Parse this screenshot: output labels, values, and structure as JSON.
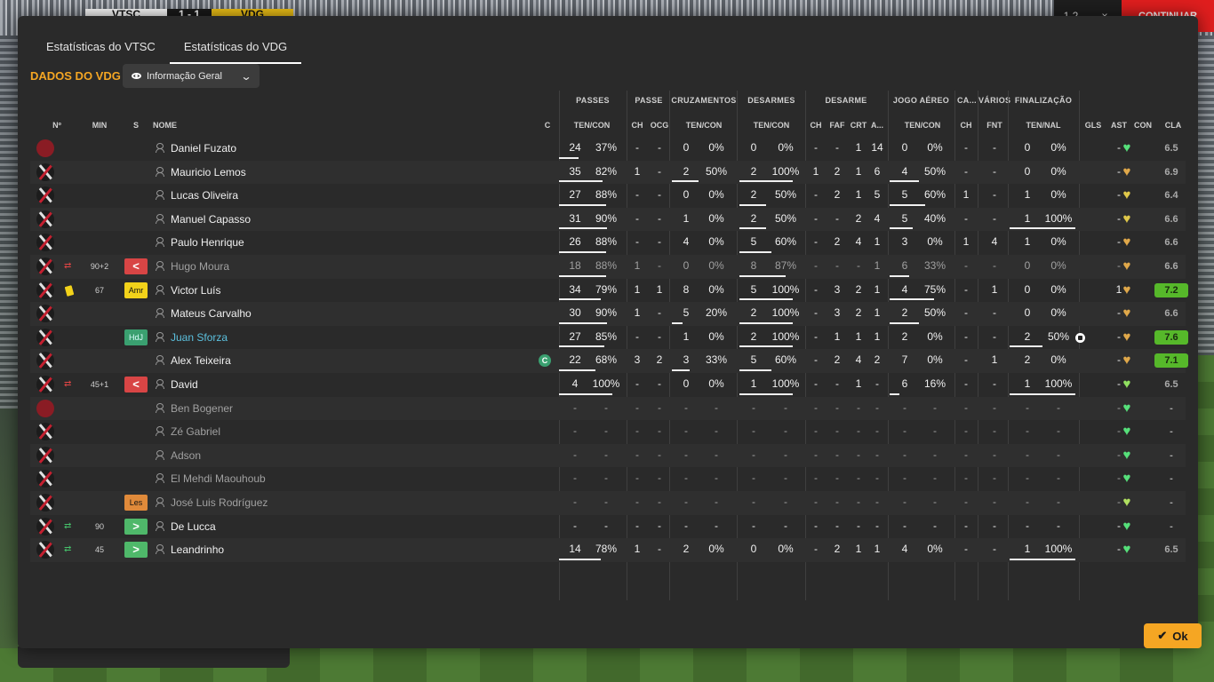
{
  "scorebar": {
    "home": "VTSC",
    "score": "1 - 1",
    "away": "VDG"
  },
  "topright": {
    "counter": "1 2",
    "close": "×",
    "continue_label": "CONTINUAR"
  },
  "tabs": [
    {
      "label": "Estatísticas do VTSC"
    },
    {
      "label": "Estatísticas do VDG"
    }
  ],
  "section_title": "DADOS DO VDG",
  "dropdown": {
    "selected": "Informação Geral",
    "icons": [
      "eye-icon",
      "chevron-down-icon"
    ]
  },
  "columns": {
    "groups": [
      "PASSES",
      "PASSE",
      "CRUZAMENTOS",
      "DESARMES",
      "DESARME",
      "JOGO AÉREO",
      "CA...",
      "VÁRIOS",
      "FINALIZAÇÃO"
    ],
    "sub": {
      "no": "Nº",
      "min": "MIN",
      "s": "S",
      "nome": "NOME",
      "c": "C",
      "passes": "TEN/CON",
      "passe_ch": "CH",
      "passe_ocg": "OCG",
      "cruz": "TEN/CON",
      "desarmes": "TEN/CON",
      "des_ch": "CH",
      "des_faf": "FAF",
      "des_crt": "CRT",
      "des_a": "A...",
      "aereo": "TEN/CON",
      "ca_ch": "CH",
      "var_fnt": "FNT",
      "fin": "TEN/NAL",
      "gls": "GLS",
      "ast": "AST",
      "con": "CON",
      "cla": "CLA"
    }
  },
  "colors": {
    "accent": "#f5a623",
    "panel": "#2a2a2a",
    "rating_good": "#56b82a",
    "link": "#5bc0de"
  },
  "players": [
    {
      "name": "Daniel Fuzato",
      "crest": "gk",
      "pas": [
        "24",
        "37%"
      ],
      "pas_f": 0.37,
      "ch": "-",
      "ocg": "-",
      "cru": [
        "0",
        "0%"
      ],
      "cru_f": 0,
      "des": [
        "0",
        "0%"
      ],
      "des_f": 0,
      "dch": "-",
      "faf": "-",
      "crt": "1",
      "a": "14",
      "aer": [
        "0",
        "0%"
      ],
      "aer_f": 0,
      "cach": "-",
      "fnt": "-",
      "fin": [
        "0",
        "0%"
      ],
      "fin_f": 0,
      "gls": "",
      "ast": "-",
      "con": "#56e07a",
      "cla": "6.5",
      "cla_good": false
    },
    {
      "name": "Mauricio Lemos",
      "pas": [
        "35",
        "82%"
      ],
      "pas_f": 0.82,
      "ch": "1",
      "ocg": "-",
      "cru": [
        "2",
        "50%"
      ],
      "cru_f": 0.5,
      "des": [
        "2",
        "100%"
      ],
      "des_f": 1,
      "dch": "1",
      "faf": "2",
      "crt": "1",
      "a": "6",
      "aer": [
        "4",
        "50%"
      ],
      "aer_f": 0.5,
      "cach": "-",
      "fnt": "-",
      "fin": [
        "0",
        "0%"
      ],
      "fin_f": 0,
      "gls": "",
      "ast": "-",
      "con": "#e0a84a",
      "cla": "6.9",
      "cla_good": false
    },
    {
      "name": "Lucas Oliveira",
      "pas": [
        "27",
        "88%"
      ],
      "pas_f": 0.88,
      "ch": "-",
      "ocg": "-",
      "cru": [
        "0",
        "0%"
      ],
      "cru_f": 0,
      "des": [
        "2",
        "50%"
      ],
      "des_f": 0.5,
      "dch": "-",
      "faf": "2",
      "crt": "1",
      "a": "5",
      "aer": [
        "5",
        "60%"
      ],
      "aer_f": 0.6,
      "cach": "1",
      "fnt": "-",
      "fin": [
        "1",
        "0%"
      ],
      "fin_f": 0,
      "gls": "",
      "ast": "-",
      "con": "#e0c84a",
      "cla": "6.4",
      "cla_good": false
    },
    {
      "name": "Manuel Capasso",
      "pas": [
        "31",
        "90%"
      ],
      "pas_f": 0.9,
      "ch": "-",
      "ocg": "-",
      "cru": [
        "1",
        "0%"
      ],
      "cru_f": 0,
      "des": [
        "2",
        "50%"
      ],
      "des_f": 0.5,
      "dch": "-",
      "faf": "-",
      "crt": "2",
      "a": "4",
      "aer": [
        "5",
        "40%"
      ],
      "aer_f": 0.4,
      "cach": "-",
      "fnt": "-",
      "fin": [
        "1",
        "100%"
      ],
      "fin_f": 1,
      "gls": "",
      "ast": "-",
      "con": "#e0c84a",
      "cla": "6.6",
      "cla_good": false
    },
    {
      "name": "Paulo Henrique",
      "pas": [
        "26",
        "88%"
      ],
      "pas_f": 0.88,
      "ch": "-",
      "ocg": "-",
      "cru": [
        "4",
        "0%"
      ],
      "cru_f": 0,
      "des": [
        "5",
        "60%"
      ],
      "des_f": 0.6,
      "dch": "-",
      "faf": "2",
      "crt": "4",
      "a": "1",
      "aer": [
        "3",
        "0%"
      ],
      "aer_f": 0,
      "cach": "1",
      "fnt": "4",
      "fin": [
        "1",
        "0%"
      ],
      "fin_f": 0,
      "gls": "",
      "ast": "-",
      "con": "#e0a84a",
      "cla": "6.6",
      "cla_good": false
    },
    {
      "name": "Hugo Moura",
      "dim": true,
      "sub": "out",
      "min": "90+2",
      "badge": "<",
      "badge_type": "red",
      "pas": [
        "18",
        "88%"
      ],
      "pas_f": 0.88,
      "ch": "1",
      "ocg": "-",
      "cru": [
        "0",
        "0%"
      ],
      "cru_f": 0,
      "des": [
        "8",
        "87%"
      ],
      "des_f": 0.87,
      "dch": "-",
      "faf": "-",
      "crt": "-",
      "a": "1",
      "aer": [
        "6",
        "33%"
      ],
      "aer_f": 0.33,
      "cach": "-",
      "fnt": "-",
      "fin": [
        "0",
        "0%"
      ],
      "fin_f": 0,
      "gls": "",
      "ast": "-",
      "con": "#e0a84a",
      "cla": "6.6",
      "cla_good": false
    },
    {
      "name": "Victor Luís",
      "card": true,
      "min": "67",
      "badge": "Amr",
      "badge_type": "amr",
      "pas": [
        "34",
        "79%"
      ],
      "pas_f": 0.79,
      "ch": "1",
      "ocg": "1",
      "cru": [
        "8",
        "0%"
      ],
      "cru_f": 0,
      "des": [
        "5",
        "100%"
      ],
      "des_f": 1,
      "dch": "-",
      "faf": "3",
      "crt": "2",
      "a": "1",
      "aer": [
        "4",
        "75%"
      ],
      "aer_f": 0.75,
      "cach": "-",
      "fnt": "1",
      "fin": [
        "0",
        "0%"
      ],
      "fin_f": 0,
      "gls": "",
      "ast": "1",
      "con": "#e0a84a",
      "cla": "7.2",
      "cla_good": true
    },
    {
      "name": "Mateus Carvalho",
      "pas": [
        "30",
        "90%"
      ],
      "pas_f": 0.9,
      "ch": "1",
      "ocg": "-",
      "cru": [
        "5",
        "20%"
      ],
      "cru_f": 0.2,
      "des": [
        "2",
        "100%"
      ],
      "des_f": 1,
      "dch": "-",
      "faf": "3",
      "crt": "2",
      "a": "1",
      "aer": [
        "2",
        "50%"
      ],
      "aer_f": 0.5,
      "cach": "-",
      "fnt": "-",
      "fin": [
        "0",
        "0%"
      ],
      "fin_f": 0,
      "gls": "",
      "ast": "-",
      "con": "#e0a84a",
      "cla": "6.6",
      "cla_good": false
    },
    {
      "name": "Juan Sforza",
      "hl": true,
      "badge": "HdJ",
      "badge_type": "hdj",
      "pas": [
        "27",
        "85%"
      ],
      "pas_f": 0.85,
      "ch": "-",
      "ocg": "-",
      "cru": [
        "1",
        "0%"
      ],
      "cru_f": 0,
      "des": [
        "2",
        "100%"
      ],
      "des_f": 1,
      "dch": "-",
      "faf": "1",
      "crt": "1",
      "a": "1",
      "aer": [
        "2",
        "0%"
      ],
      "aer_f": 0,
      "cach": "-",
      "fnt": "-",
      "fin": [
        "2",
        "50%"
      ],
      "fin_f": 0.5,
      "gls": "ball",
      "ast": "-",
      "con": "#e0a84a",
      "cla": "7.6",
      "cla_good": true
    },
    {
      "name": "Alex Teixeira",
      "captain": "C",
      "pas": [
        "22",
        "68%"
      ],
      "pas_f": 0.68,
      "ch": "3",
      "ocg": "2",
      "cru": [
        "3",
        "33%"
      ],
      "cru_f": 0.33,
      "des": [
        "5",
        "60%"
      ],
      "des_f": 0.6,
      "dch": "-",
      "faf": "2",
      "crt": "4",
      "a": "2",
      "aer": [
        "7",
        "0%"
      ],
      "aer_f": 0,
      "cach": "-",
      "fnt": "1",
      "fin": [
        "2",
        "0%"
      ],
      "fin_f": 0,
      "gls": "",
      "ast": "-",
      "con": "#e0a84a",
      "cla": "7.1",
      "cla_good": true
    },
    {
      "name": "David",
      "sub": "out",
      "min": "45+1",
      "badge": "<",
      "badge_type": "red",
      "pas": [
        "4",
        "100%"
      ],
      "pas_f": 1,
      "ch": "-",
      "ocg": "-",
      "cru": [
        "0",
        "0%"
      ],
      "cru_f": 0,
      "des": [
        "1",
        "100%"
      ],
      "des_f": 1,
      "dch": "-",
      "faf": "-",
      "crt": "1",
      "a": "-",
      "aer": [
        "6",
        "16%"
      ],
      "aer_f": 0.16,
      "cach": "-",
      "fnt": "-",
      "fin": [
        "1",
        "100%"
      ],
      "fin_f": 1,
      "gls": "",
      "ast": "-",
      "con": "#90e060",
      "cla": "6.5",
      "cla_good": false
    },
    {
      "name": "Ben Bogener",
      "dim": true,
      "crest": "gk",
      "empty": true,
      "con": "#56e07a",
      "cla": "-"
    },
    {
      "name": "Zé Gabriel",
      "dim": true,
      "empty": true,
      "con": "#56e07a",
      "cla": "-"
    },
    {
      "name": "Adson",
      "dim": true,
      "empty": true,
      "con": "#56e07a",
      "cla": "-"
    },
    {
      "name": "El Mehdi Maouhoub",
      "dim": true,
      "empty": true,
      "con": "#56e07a",
      "cla": "-"
    },
    {
      "name": "José Luis Rodríguez",
      "dim": true,
      "empty": true,
      "badge": "Les",
      "badge_type": "les",
      "con": "#b0e060",
      "cla": "-"
    },
    {
      "name": "De Lucca",
      "sub": "in",
      "min": "90",
      "badge": ">",
      "badge_type": "green",
      "empty": true,
      "con": "#56e07a",
      "cla": "-"
    },
    {
      "name": "Leandrinho",
      "sub": "in",
      "min": "45",
      "badge": ">",
      "badge_type": "green",
      "pas": [
        "14",
        "78%"
      ],
      "pas_f": 0.78,
      "ch": "1",
      "ocg": "-",
      "cru": [
        "2",
        "0%"
      ],
      "cru_f": 0,
      "des": [
        "0",
        "0%"
      ],
      "des_f": 0,
      "dch": "-",
      "faf": "2",
      "crt": "1",
      "a": "1",
      "aer": [
        "4",
        "0%"
      ],
      "aer_f": 0,
      "cach": "-",
      "fnt": "-",
      "fin": [
        "1",
        "100%"
      ],
      "fin_f": 1,
      "gls": "",
      "ast": "-",
      "con": "#56e07a",
      "cla": "6.5",
      "cla_good": false
    }
  ],
  "ok_label": "Ok"
}
